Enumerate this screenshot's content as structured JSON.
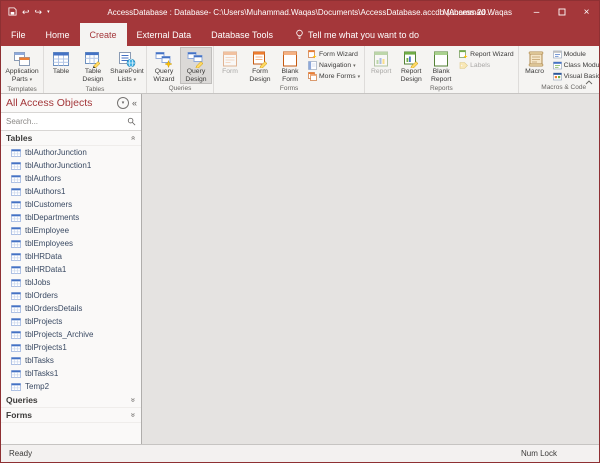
{
  "glyphs": {
    "dropdown": "▾",
    "minimize": "–",
    "close": "×",
    "undo": "↩",
    "redo": "↪",
    "chevrons": "«"
  },
  "title_bar": {
    "title": "AccessDatabase : Database- C:\\Users\\Muhammad.Waqas\\Documents\\AccessDatabase.accdb (Access 20...",
    "user": "Muhammad Waqas"
  },
  "tabs": [
    "File",
    "Home",
    "Create",
    "External Data",
    "Database Tools"
  ],
  "tell_me": "Tell me what you want to do",
  "ribbon": {
    "groups": [
      {
        "label": "Templates",
        "buttons": [
          {
            "label": "Application Parts"
          }
        ]
      },
      {
        "label": "Tables",
        "buttons": [
          {
            "label": "Table"
          },
          {
            "label": "Table Design"
          },
          {
            "label": "SharePoint Lists"
          }
        ]
      },
      {
        "label": "Queries",
        "buttons": [
          {
            "label": "Query Wizard"
          },
          {
            "label": "Query Design"
          }
        ]
      },
      {
        "label": "Forms",
        "big": [
          {
            "label": "Form"
          },
          {
            "label": "Form Design"
          },
          {
            "label": "Blank Form"
          }
        ],
        "small": [
          {
            "label": "Form Wizard"
          },
          {
            "label": "Navigation"
          },
          {
            "label": "More Forms"
          }
        ]
      },
      {
        "label": "Reports",
        "big": [
          {
            "label": "Report"
          },
          {
            "label": "Report Design"
          },
          {
            "label": "Blank Report"
          }
        ],
        "small": [
          {
            "label": "Report Wizard"
          },
          {
            "label": "Labels"
          }
        ]
      },
      {
        "label": "Macros & Code",
        "big": [
          {
            "label": "Macro"
          }
        ],
        "small": [
          {
            "label": "Module"
          },
          {
            "label": "Class Module"
          },
          {
            "label": "Visual Basic"
          }
        ]
      }
    ]
  },
  "nav": {
    "title": "All Access Objects",
    "search_placeholder": "Search...",
    "sections": {
      "tables": "Tables",
      "queries": "Queries",
      "forms": "Forms"
    },
    "tables_items": [
      "tblAuthorJunction",
      "tblAuthorJunction1",
      "tblAuthors",
      "tblAuthors1",
      "tblCustomers",
      "tblDepartments",
      "tblEmployee",
      "tblEmployees",
      "tblHRData",
      "tblHRData1",
      "tblJobs",
      "tblOrders",
      "tblOrdersDetails",
      "tblProjects",
      "tblProjects_Archive",
      "tblProjects1",
      "tblTasks",
      "tblTasks1",
      "Temp2"
    ]
  },
  "status_bar": {
    "left": "Ready",
    "right": "Num Lock"
  }
}
